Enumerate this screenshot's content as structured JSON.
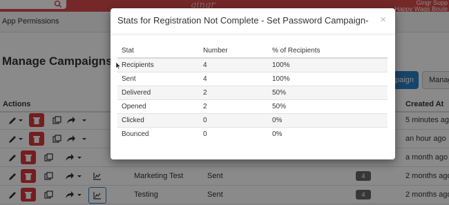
{
  "topbar": {
    "brand": "gingr",
    "user_line1": "Gingr Supp",
    "user_line2": "Happy Wags Boule",
    "colors": {
      "bar": "#d84a4a",
      "primary": "#2b7fc4",
      "danger": "#d9373b"
    }
  },
  "subnav": {
    "app_permissions": "App Permissions"
  },
  "page": {
    "title": "Manage Campaigns",
    "new_campaign_button": "paign",
    "manage_button": "Manag",
    "columns": {
      "actions": "Actions",
      "created_at": "Created At"
    }
  },
  "rows": [
    {
      "name": "",
      "status": "",
      "count": "",
      "created": "5 minutes ago"
    },
    {
      "name": "",
      "status": "",
      "count": "",
      "created": "an hour ago"
    },
    {
      "name": "",
      "status": "",
      "count": "",
      "created": "a month ago"
    },
    {
      "name": "Marketing Test",
      "status": "Sent",
      "count": "4",
      "created": "2 months ago"
    },
    {
      "name": "Testing",
      "status": "Sent",
      "count": "4",
      "created": "2 months ago"
    }
  ],
  "modal": {
    "title": "Stats for Registration Not Complete - Set Password Campaign-",
    "close_symbol": "×",
    "headers": {
      "stat": "Stat",
      "number": "Number",
      "percent": "% of Recipients"
    },
    "stats": [
      {
        "stat": "Recipients",
        "number": "4",
        "percent": "100%"
      },
      {
        "stat": "Sent",
        "number": "4",
        "percent": "100%"
      },
      {
        "stat": "Delivered",
        "number": "2",
        "percent": "50%"
      },
      {
        "stat": "Opened",
        "number": "2",
        "percent": "50%"
      },
      {
        "stat": "Clicked",
        "number": "0",
        "percent": "0%"
      },
      {
        "stat": "Bounced",
        "number": "0",
        "percent": "0%"
      }
    ]
  }
}
